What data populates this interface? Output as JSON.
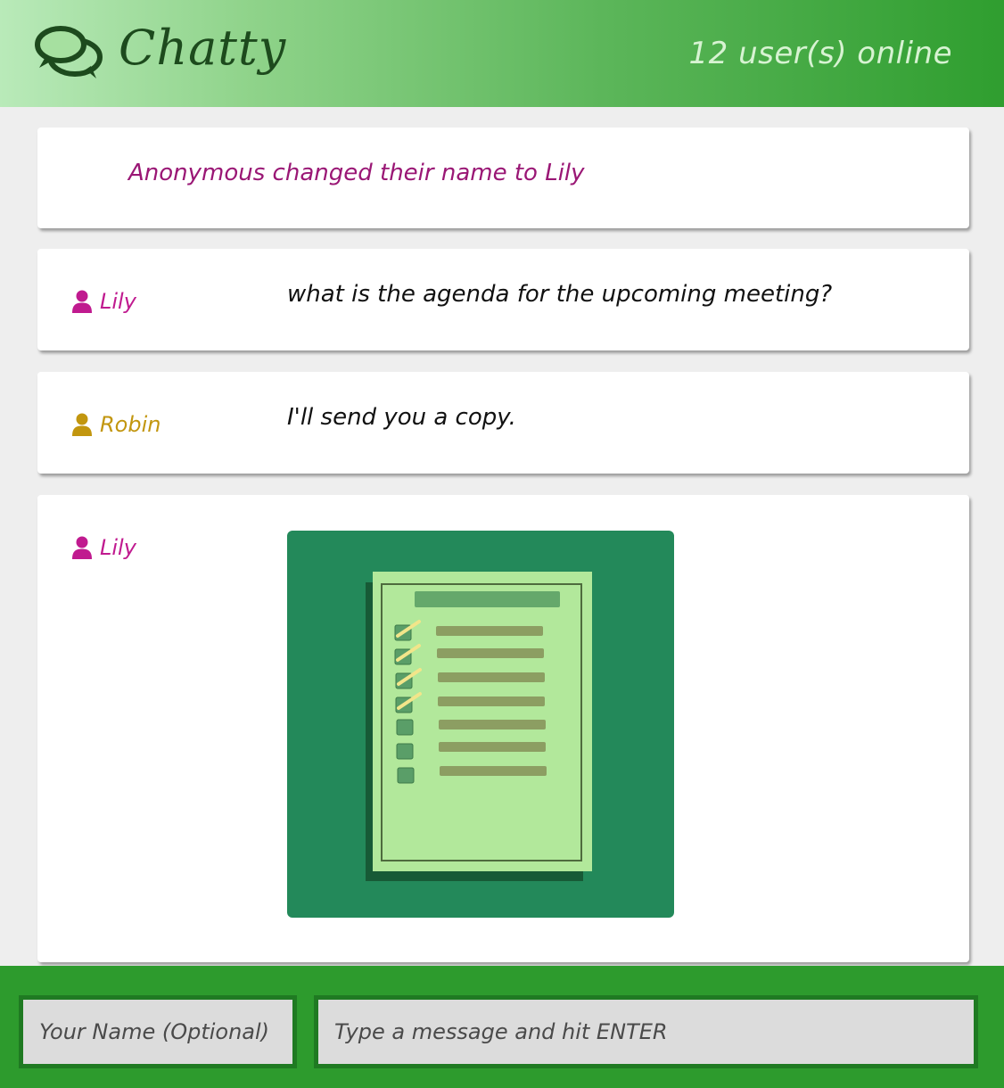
{
  "header": {
    "title": "Chatty",
    "online": "12 user(s) online",
    "logo_icon": "chat-bubbles-icon"
  },
  "messages": [
    {
      "type": "system",
      "text": "Anonymous changed their name to Lily"
    },
    {
      "type": "text",
      "author": "Lily",
      "author_color": "#c01a8f",
      "text": "what is the agenda for the upcoming meeting?"
    },
    {
      "type": "text",
      "author": "Robin",
      "author_color": "#c2960f",
      "text": "I'll send you a copy."
    },
    {
      "type": "image",
      "author": "Lily",
      "author_color": "#c01a8f",
      "image": "checklist-document-icon"
    }
  ],
  "input": {
    "name_placeholder": "Your Name (Optional)",
    "message_placeholder": "Type a message and hit ENTER"
  },
  "colors": {
    "header_end": "#2f9e2f",
    "footer": "#2d9b2d",
    "system_text": "#9a1775",
    "attachment_bg": "#23895a"
  }
}
